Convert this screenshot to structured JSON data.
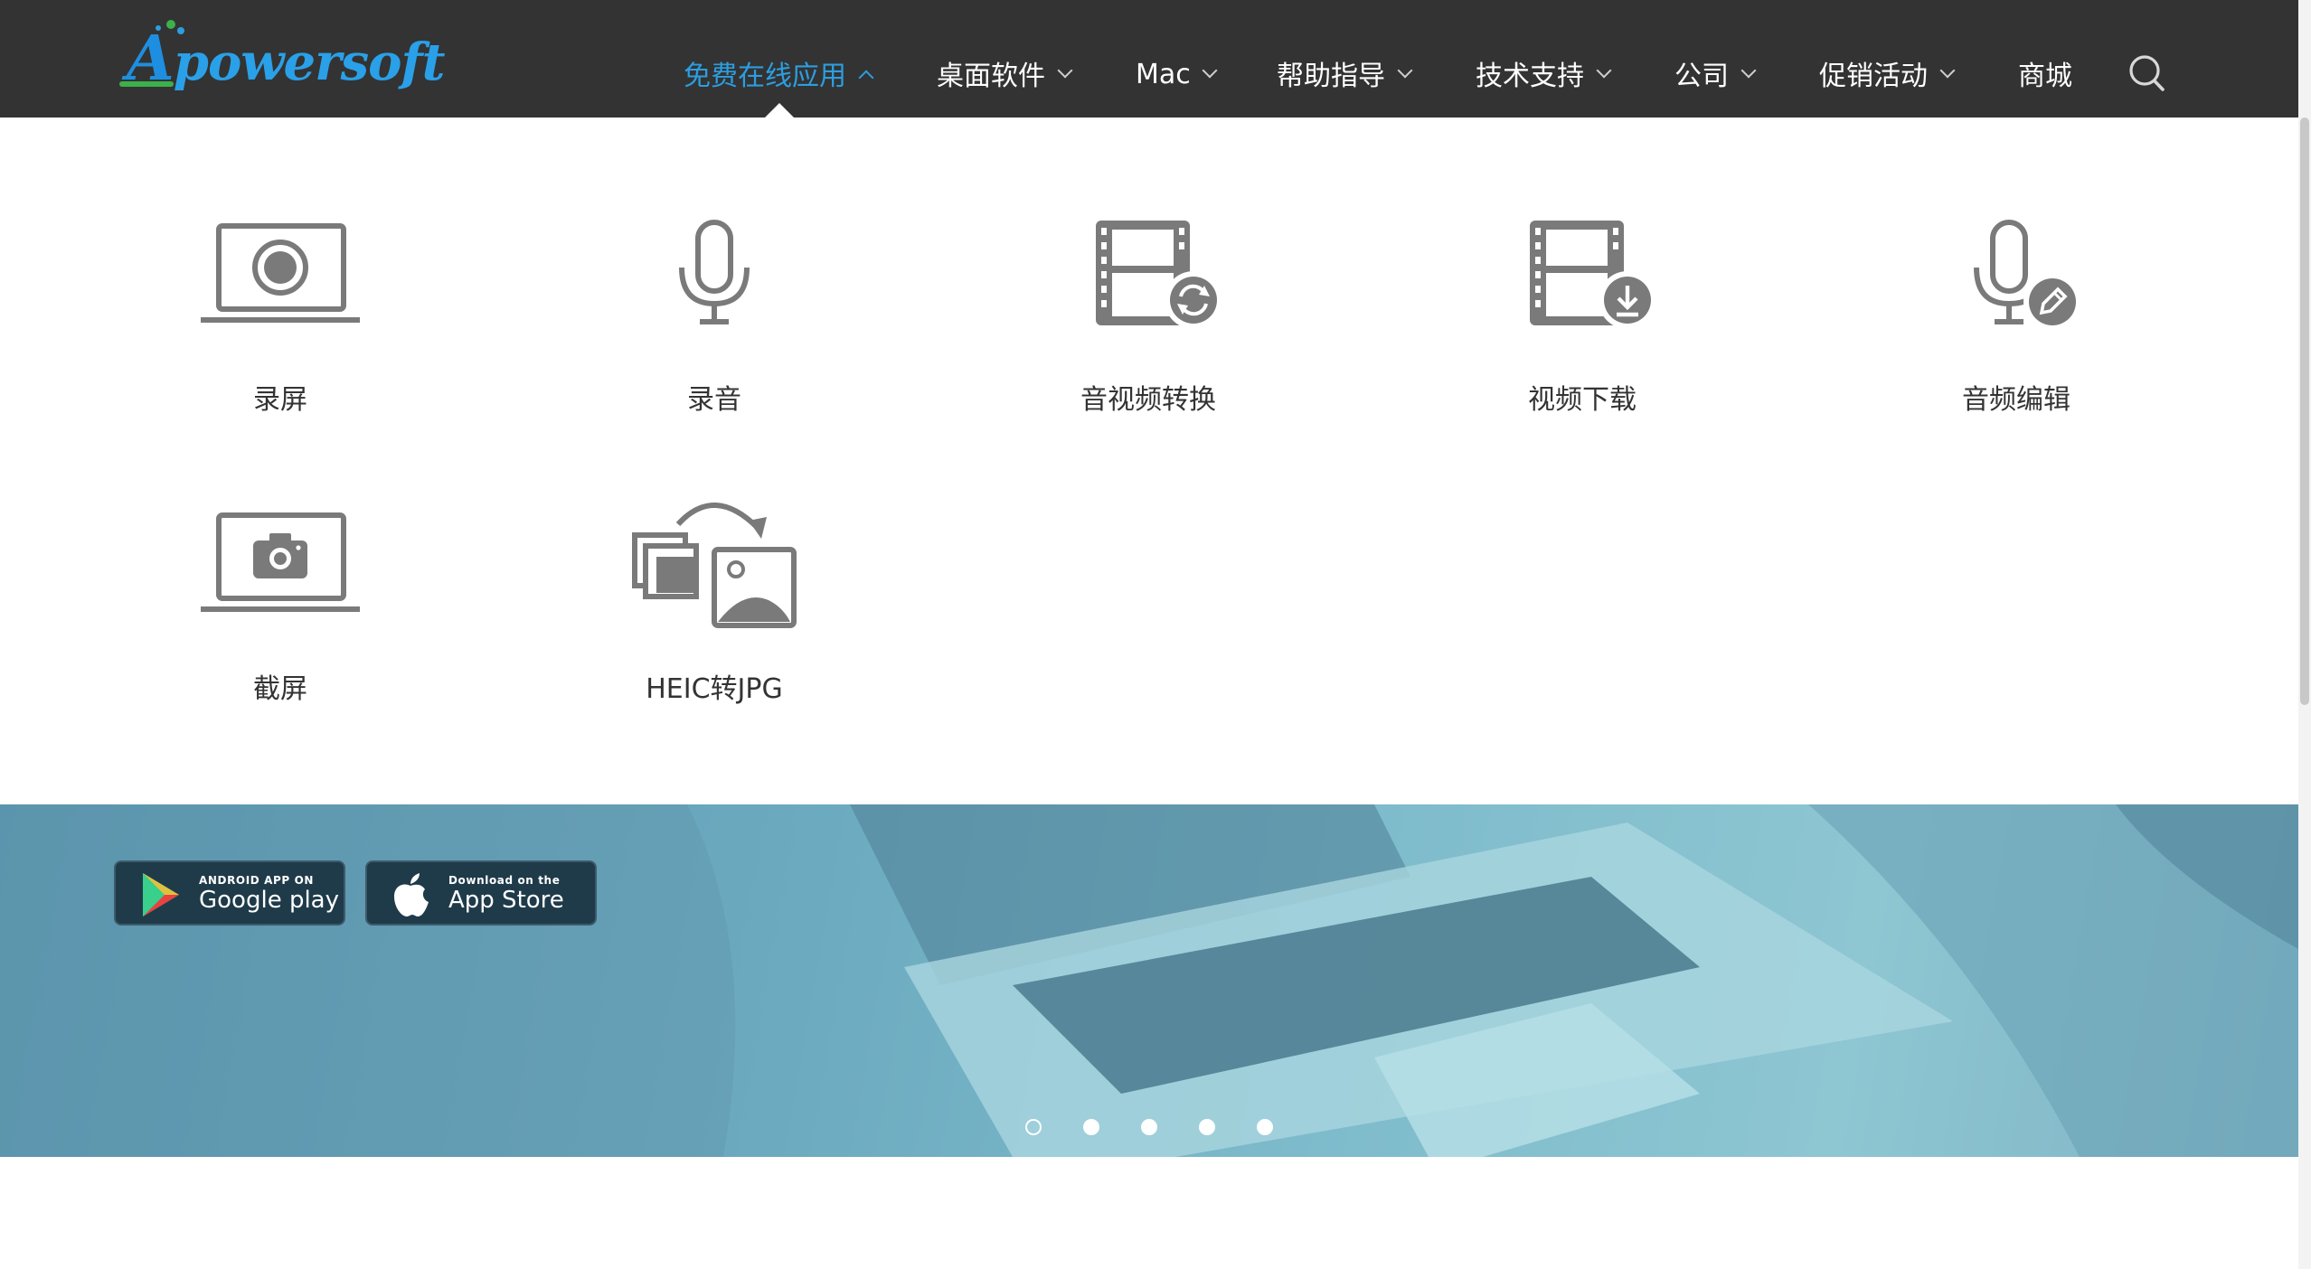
{
  "brand": {
    "logo_text_first": "A",
    "logo_text_rest": "powersoft",
    "colors": {
      "accent": "#2c9ee0",
      "header_bg": "#333333",
      "icon_gray": "#7a7a7a",
      "logo_green": "#3cb04a"
    }
  },
  "nav": {
    "items": [
      {
        "label": "免费在线应用",
        "has_dropdown": true,
        "active": true
      },
      {
        "label": "桌面软件",
        "has_dropdown": true,
        "active": false
      },
      {
        "label": "Mac",
        "has_dropdown": true,
        "active": false
      },
      {
        "label": "帮助指导",
        "has_dropdown": true,
        "active": false
      },
      {
        "label": "技术支持",
        "has_dropdown": true,
        "active": false
      },
      {
        "label": "公司",
        "has_dropdown": true,
        "active": false
      },
      {
        "label": "促销活动",
        "has_dropdown": true,
        "active": false
      },
      {
        "label": "商城",
        "has_dropdown": false,
        "active": false
      }
    ],
    "search_icon": "search-icon"
  },
  "dropdown": {
    "apps": [
      {
        "label": "录屏",
        "icon": "screen-record-icon"
      },
      {
        "label": "录音",
        "icon": "microphone-icon"
      },
      {
        "label": "音视频转换",
        "icon": "video-convert-icon"
      },
      {
        "label": "视频下载",
        "icon": "video-download-icon"
      },
      {
        "label": "音频编辑",
        "icon": "audio-edit-icon"
      },
      {
        "label": "截屏",
        "icon": "screenshot-camera-icon"
      },
      {
        "label": "HEIC转JPG",
        "icon": "heic-to-jpg-icon"
      }
    ]
  },
  "banner": {
    "google_play": {
      "small": "ANDROID APP ON",
      "big": "Google play",
      "icon": "google-play-icon"
    },
    "app_store": {
      "small": "Download on the",
      "big": "App Store",
      "icon": "apple-icon"
    },
    "slides": {
      "count": 5,
      "active_index": 0
    }
  }
}
